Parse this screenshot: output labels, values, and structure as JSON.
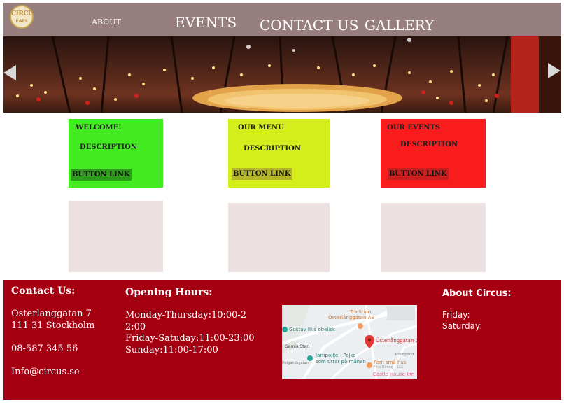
{
  "header": {
    "logo": {
      "line1": "CIRCUS",
      "line2": "EATS"
    },
    "nav": {
      "about": "ABOUT",
      "events": "EVENTS",
      "contact": "CONTACT US",
      "gallery": "GALLERY"
    }
  },
  "slider": {
    "prev_icon": "chevron-left-icon",
    "next_icon": "chevron-right-icon"
  },
  "cards": [
    {
      "title": "WELCOME!",
      "description": "DESCRIPTION",
      "button": "BUTTON LINK",
      "color": "#42ec21"
    },
    {
      "title": "OUR MENU",
      "description": "DESCRIPTION",
      "button": "BUTTON LINK",
      "color": "#d3ee1a"
    },
    {
      "title": "OUR EVENTS",
      "description": "DESCRIPTION",
      "button": "BUTTON LINK",
      "color": "#f91c1c"
    }
  ],
  "footer": {
    "contact": {
      "heading": "Contact Us:",
      "street": "Osterlanggatan 7",
      "city": "111 31 Stockholm",
      "phone": "08-587 345 56",
      "email": "Info@circus.se"
    },
    "hours": {
      "heading": "Opening Hours:",
      "line1": "Monday-Thursday:10:00-2",
      "line2": "2:00",
      "line3": "Friday-Satuday:11:00-23:00",
      "line4": "Sunday:11:00-17:00"
    },
    "map": {
      "tradition": "Tradition",
      "tradition_sub": "Österlånggatan AB",
      "gustav": "Gustav III:s obelisk",
      "gamla": "Gamla Stan",
      "jarnpojke": "Järnpojke - Pojke",
      "jarnpojke_sub": "som tittar på månen",
      "osterlang": "Österlånggatan 7",
      "fem": "Fem små hus",
      "fem_sub": "Fine Dining · $$$",
      "castle": "Castle House Inn",
      "bredgrand": "Bredgränd",
      "helgand": "Helgandsgatan",
      "pin_icon": "map-pin-icon"
    },
    "about": {
      "heading": "About Circus:",
      "friday": "Friday:",
      "saturday": "Saturday:"
    },
    "colors": {
      "background": "#a50012"
    }
  },
  "colors": {
    "header": "#987f7f",
    "placeholder": "#ecdfe0"
  }
}
